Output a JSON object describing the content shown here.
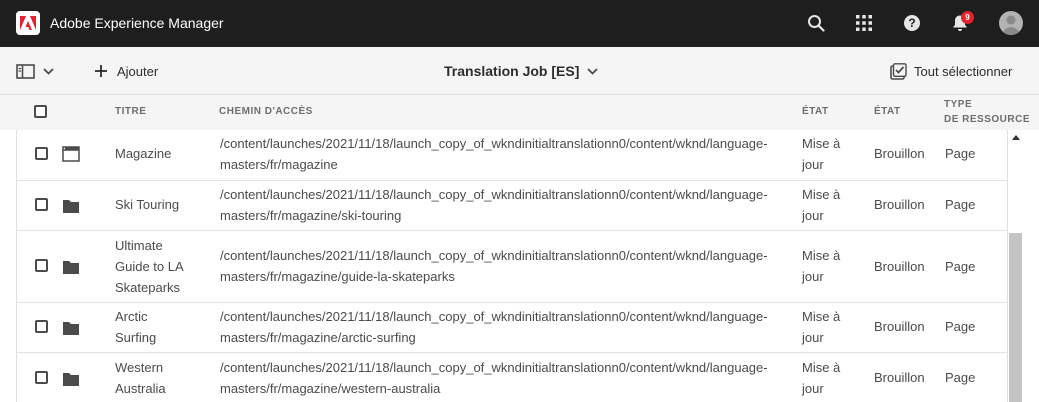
{
  "app": {
    "title": "Adobe Experience Manager",
    "notification_count": "9",
    "accent_color": "#e3232f"
  },
  "actionbar": {
    "add_label": "Ajouter",
    "job_title": "Translation Job [ES]",
    "select_all_label": "Tout sélectionner"
  },
  "table": {
    "headers": {
      "title": "TITRE",
      "path": "CHEMIN D'ACCÈS",
      "state1": "ÉTAT",
      "state2": "ÉTAT",
      "type_line1": "TYPE",
      "type_line2": "DE RESSOURCE"
    },
    "rows": [
      {
        "icon": "page-icon",
        "title": [
          "Magazine"
        ],
        "path": [
          "/content/launches/2021/11/18/launch_copy_of_wkndinitialtranslationn0/content/wknd/language-",
          "masters/fr/magazine"
        ],
        "state1": [
          "Mise à",
          "jour"
        ],
        "state2": "Brouillon",
        "type": "Page"
      },
      {
        "icon": "folder-icon",
        "title": [
          "Ski Touring"
        ],
        "path": [
          "/content/launches/2021/11/18/launch_copy_of_wkndinitialtranslationn0/content/wknd/language-",
          "masters/fr/magazine/ski-touring"
        ],
        "state1": [
          "Mise à",
          "jour"
        ],
        "state2": "Brouillon",
        "type": "Page"
      },
      {
        "icon": "folder-icon",
        "title": [
          "Ultimate",
          "Guide to LA",
          "Skateparks"
        ],
        "path": [
          "/content/launches/2021/11/18/launch_copy_of_wkndinitialtranslationn0/content/wknd/language-",
          "masters/fr/magazine/guide-la-skateparks"
        ],
        "state1": [
          "Mise à",
          "jour"
        ],
        "state2": "Brouillon",
        "type": "Page"
      },
      {
        "icon": "folder-icon",
        "title": [
          "Arctic",
          "Surfing"
        ],
        "path": [
          "/content/launches/2021/11/18/launch_copy_of_wkndinitialtranslationn0/content/wknd/language-",
          "masters/fr/magazine/arctic-surfing"
        ],
        "state1": [
          "Mise à",
          "jour"
        ],
        "state2": "Brouillon",
        "type": "Page"
      },
      {
        "icon": "folder-icon",
        "title": [
          "Western",
          "Australia"
        ],
        "path": [
          "/content/launches/2021/11/18/launch_copy_of_wkndinitialtranslationn0/content/wknd/language-",
          "masters/fr/magazine/western-australia"
        ],
        "state1": [
          "Mise à",
          "jour"
        ],
        "state2": "Brouillon",
        "type": "Page"
      }
    ]
  }
}
